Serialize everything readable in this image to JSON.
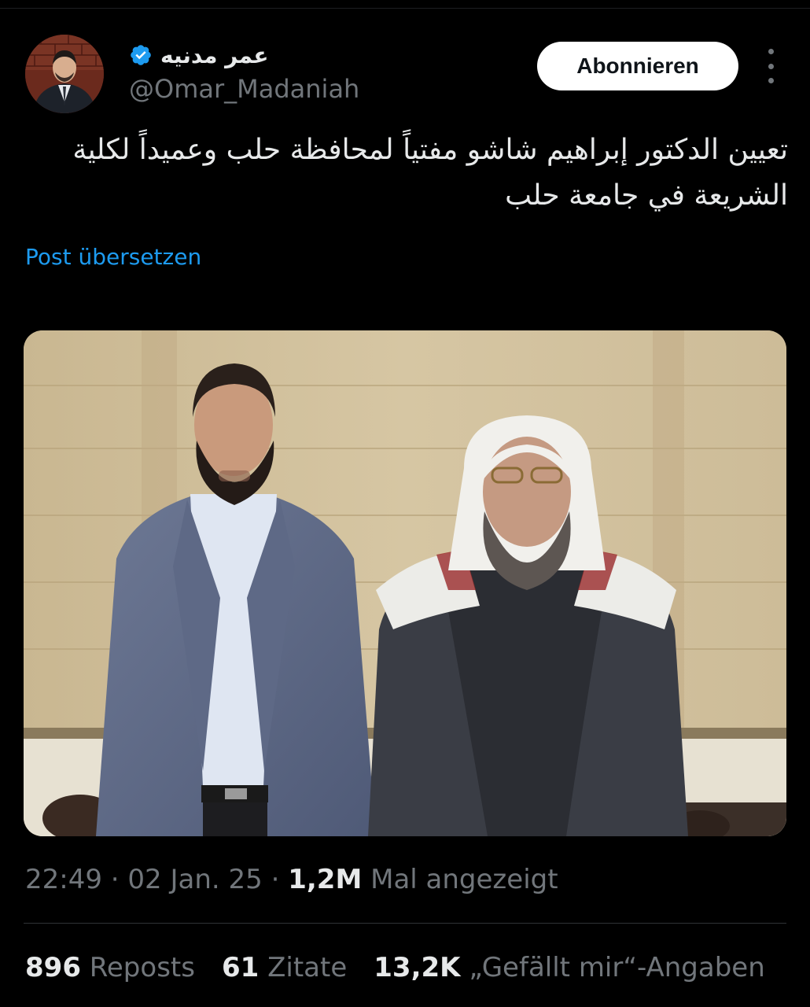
{
  "author": {
    "display_name": "عمر مدنيه",
    "handle": "@Omar_Madaniah",
    "verified": true
  },
  "actions": {
    "follow_label": "Abonnieren"
  },
  "tweet": {
    "text": "تعيين الدكتور إبراهيم شاشو مفتياً لمحافظة حلب وعميداً لكلية الشريعة في جامعة حلب",
    "translate_label": "Post übersetzen"
  },
  "meta": {
    "time": "22:49",
    "date": "02 Jan. 25",
    "views_count": "1,2M",
    "views_label": "Mal angezeigt"
  },
  "stats": {
    "reposts_count": "896",
    "reposts_label": "Reposts",
    "quotes_count": "61",
    "quotes_label": "Zitate",
    "likes_count": "13,2K",
    "likes_label": "„Gefällt mir“-Angaben"
  },
  "colors": {
    "background": "#000000",
    "text_primary": "#e7e9ea",
    "text_secondary": "#71767b",
    "link": "#1d9bf0",
    "verified": "#1d9bf0"
  },
  "icons": {
    "verified": "verified-badge-icon",
    "more": "more-vertical-icon"
  }
}
